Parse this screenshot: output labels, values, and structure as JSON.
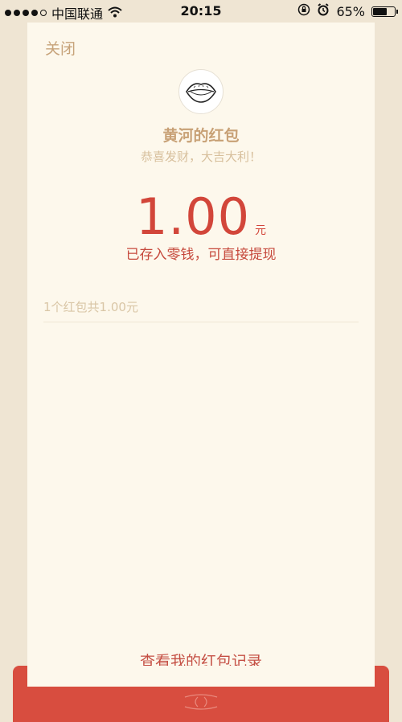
{
  "status_bar": {
    "carrier": "中国联通",
    "time": "20:15",
    "battery_percent": "65%",
    "battery_level": 0.65,
    "icons": [
      "signal-dots-icon",
      "wifi-icon",
      "rotation-lock-icon",
      "alarm-icon",
      "battery-icon"
    ]
  },
  "header": {
    "close_label": "关闭"
  },
  "packet": {
    "sender": "黄河的红包",
    "greeting": "恭喜发财，大吉大利！",
    "amount": "1.00",
    "unit": "元",
    "stored_note": "已存入零钱，可直接提现"
  },
  "summary": {
    "text": "1个红包共1.00元"
  },
  "footer": {
    "records_label": "查看我的红包记录"
  },
  "colors": {
    "accent_red": "#d2463a",
    "gold_text": "#c8a176",
    "background": "#fdf8ec"
  }
}
